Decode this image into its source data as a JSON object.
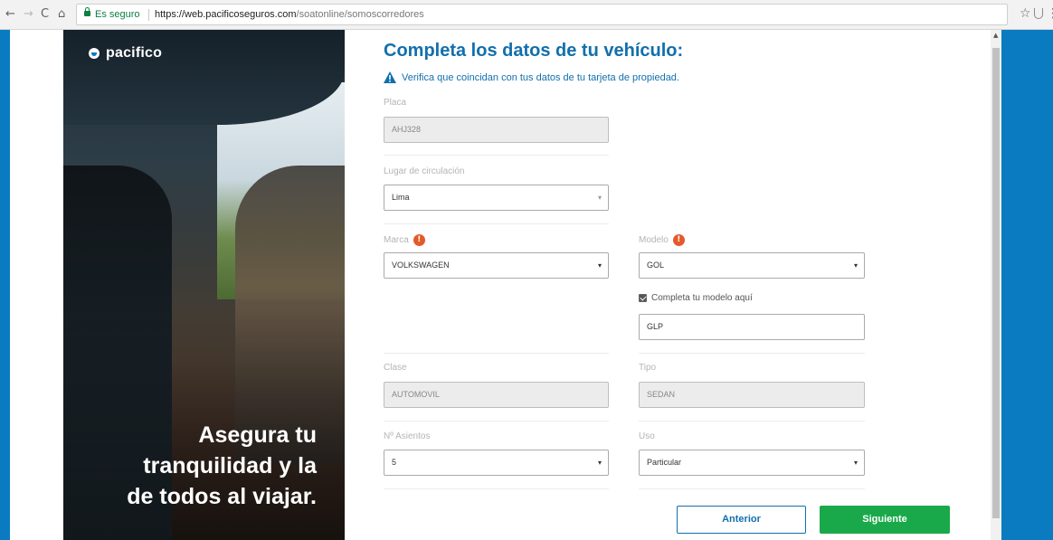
{
  "browser": {
    "secure_label": "Es seguro",
    "url_host": "https://web.pacificoseguros.com",
    "url_path": "/soatonline/somoscorredores"
  },
  "colors": {
    "brand_blue": "#0a7bc1",
    "title_blue": "#126fad",
    "next_green": "#1aa94a",
    "alert_orange": "#e35a2b"
  },
  "icons": {
    "back": "arrow-left-icon",
    "forward": "arrow-right-icon",
    "reload": "reload-icon",
    "home": "home-icon",
    "lock": "lock-icon",
    "star": "star-icon",
    "extension": "extension-icon",
    "menu": "kebab-menu-icon",
    "warning": "warning-triangle-icon",
    "alert": "alert-circle-icon"
  },
  "hero": {
    "brand": "pacifico",
    "slogan_line1": "Asegura tu",
    "slogan_line2": "tranquilidad y la",
    "slogan_line3": "de todos al viajar."
  },
  "form": {
    "title": "Completa los datos de tu vehículo:",
    "notice": "Verifica que coincidan con tus datos de tu tarjeta de propiedad.",
    "placa": {
      "label": "Placa",
      "value": "AHJ328"
    },
    "lugar": {
      "label": "Lugar de circulación",
      "value": "Lima"
    },
    "marca": {
      "label": "Marca",
      "value": "VOLKSWAGEN"
    },
    "modelo": {
      "label": "Modelo",
      "value": "GOL"
    },
    "completa_modelo": {
      "label": "Completa tu modelo aquí",
      "checked": true,
      "value": "GLP"
    },
    "clase": {
      "label": "Clase",
      "value": "AUTOMOVIL"
    },
    "tipo": {
      "label": "Tipo",
      "value": "SEDAN"
    },
    "asientos": {
      "label": "Nº Asientos",
      "value": "5"
    },
    "uso": {
      "label": "Uso",
      "value": "Particular"
    },
    "alert_symbol": "!",
    "select_arrow": "▾"
  },
  "buttons": {
    "prev": "Anterior",
    "next": "Siguiente"
  },
  "glyphs": {
    "back": "←",
    "forward": "→",
    "reload": "C",
    "home": "⌂",
    "star": "☆",
    "menu": "⋮",
    "scroll_up": "▲"
  }
}
